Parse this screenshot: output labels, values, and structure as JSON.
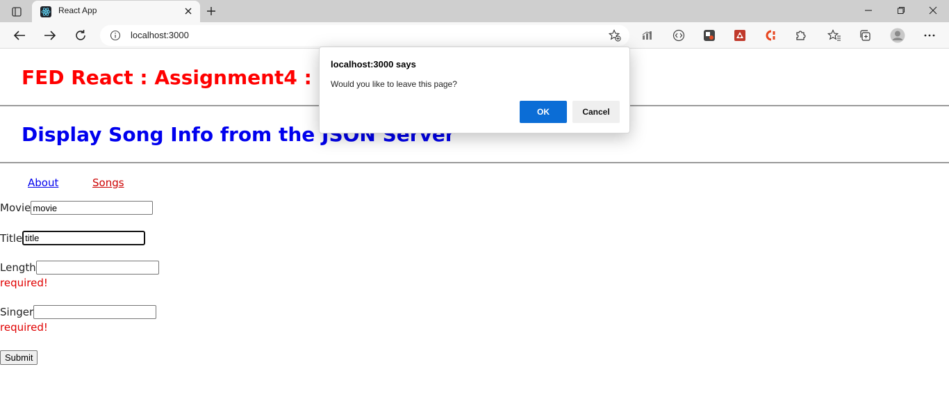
{
  "browser": {
    "tab_title": "React App",
    "address": "localhost:3000",
    "icons": {
      "tab_actions": "tab-actions-icon",
      "favicon": "react-logo-icon",
      "tab_close": "close-icon",
      "new_tab": "plus-icon",
      "minimize": "minimize-icon",
      "restore": "restore-icon",
      "close_window": "close-icon",
      "back": "back-arrow-icon",
      "forward": "forward-arrow-icon",
      "refresh": "refresh-icon",
      "site_info": "info-icon",
      "add_favorite": "star-plus-icon",
      "extensions": [
        "chart-extension-icon",
        "code-extension-icon",
        "extension-icon-2",
        "extension-icon-3",
        "c-extension-icon",
        "puzzle-extensions-icon"
      ],
      "favorites": "favorites-icon",
      "collections": "collections-icon",
      "profile": "profile-avatar-icon",
      "menu": "more-menu-icon"
    }
  },
  "page": {
    "heading1": "FED React : Assignment4 : Rou",
    "heading2": "Display Song Info from the JSON Server",
    "nav": {
      "about": "About",
      "songs": "Songs"
    },
    "form": {
      "movie_label": "Movie",
      "movie_value": "movie",
      "title_label": "Title",
      "title_value": "title",
      "length_label": "Length",
      "length_value": "",
      "length_error": "required!",
      "singer_label": "Singer",
      "singer_value": "",
      "singer_error": "required!",
      "submit_label": "Submit"
    }
  },
  "dialog": {
    "title": "localhost:3000 says",
    "message": "Would you like to leave this page?",
    "ok_label": "OK",
    "cancel_label": "Cancel"
  },
  "colors": {
    "heading1": "#ff0000",
    "heading2": "#0000ee",
    "link_about": "#0000ee",
    "link_songs": "#cc0000",
    "error": "#e00000",
    "dialog_ok": "#0b6dd6"
  }
}
